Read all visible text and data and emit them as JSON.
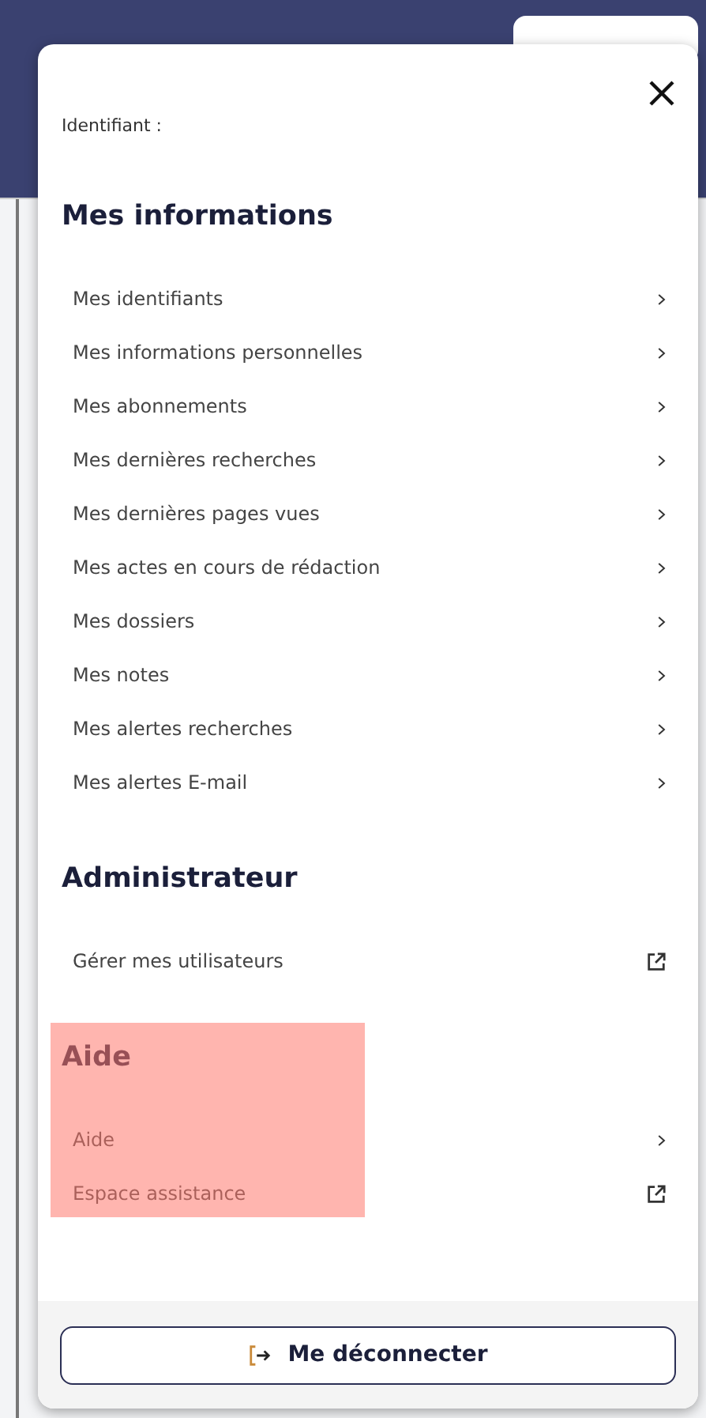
{
  "panel": {
    "identifiant_label": "Identifiant :",
    "sections": [
      {
        "title": "Mes informations",
        "highlighted": false,
        "items": [
          {
            "label": "Mes identifiants",
            "kind": "chevron"
          },
          {
            "label": "Mes informations personnelles",
            "kind": "chevron"
          },
          {
            "label": "Mes abonnements",
            "kind": "chevron"
          },
          {
            "label": "Mes dernières recherches",
            "kind": "chevron"
          },
          {
            "label": "Mes dernières pages vues",
            "kind": "chevron"
          },
          {
            "label": "Mes actes en cours de rédaction",
            "kind": "chevron"
          },
          {
            "label": "Mes dossiers",
            "kind": "chevron"
          },
          {
            "label": "Mes notes",
            "kind": "chevron"
          },
          {
            "label": "Mes alertes recherches",
            "kind": "chevron"
          },
          {
            "label": "Mes alertes E-mail",
            "kind": "chevron"
          }
        ]
      },
      {
        "title": "Administrateur",
        "highlighted": false,
        "items": [
          {
            "label": "Gérer mes utilisateurs",
            "kind": "external"
          }
        ]
      },
      {
        "title": "Aide",
        "highlighted": true,
        "items": [
          {
            "label": "Aide",
            "kind": "chevron"
          },
          {
            "label": "Espace assistance",
            "kind": "external"
          }
        ]
      }
    ],
    "logout_button": "Me déconnecter"
  }
}
